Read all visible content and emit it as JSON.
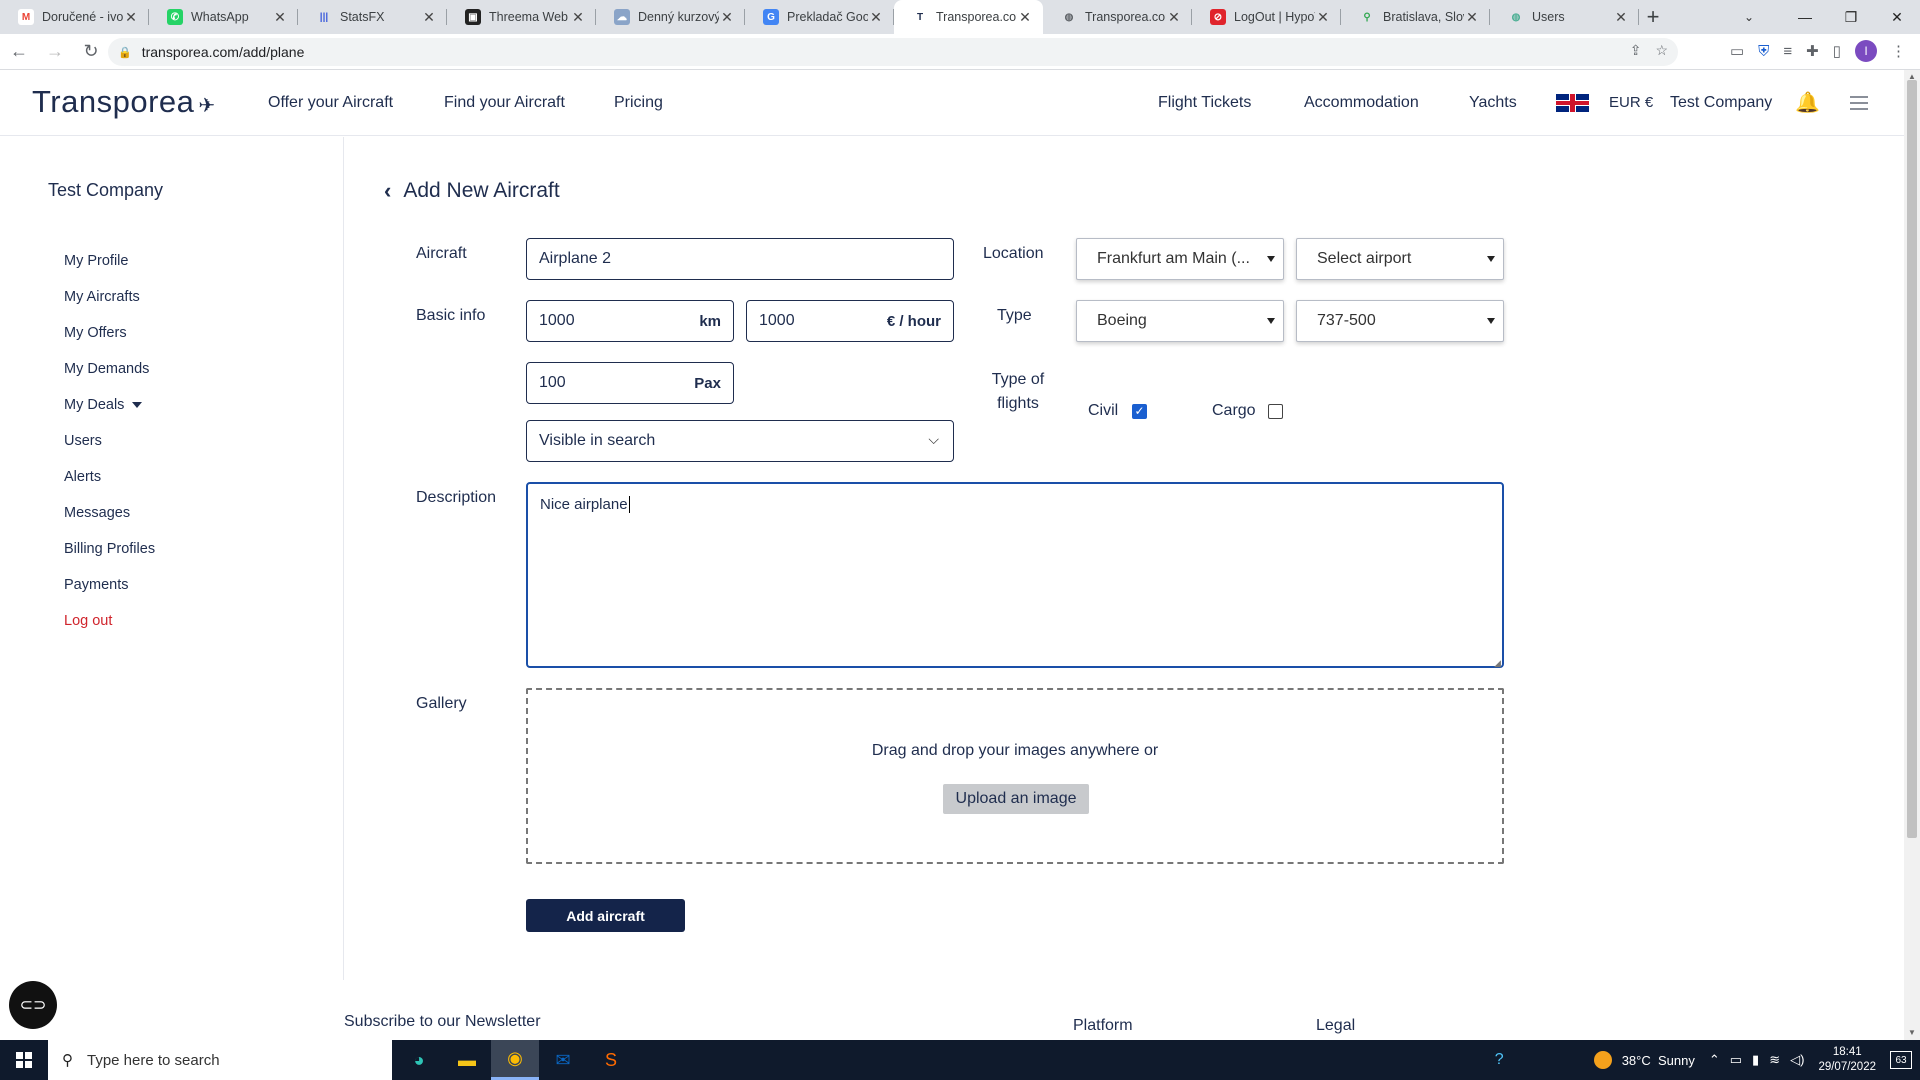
{
  "browser": {
    "tabs": [
      {
        "label": "Doručené - ivor",
        "favicon": "gmail-icon",
        "color": "#ea4335",
        "glyph": "M"
      },
      {
        "label": "WhatsApp",
        "favicon": "whatsapp-icon",
        "color": "#25d366",
        "glyph": "✆"
      },
      {
        "label": "StatsFX",
        "favicon": "statsfx-icon",
        "color": "#3b5bdb",
        "glyph": "|||"
      },
      {
        "label": "Threema Web",
        "favicon": "threema-icon",
        "color": "#222222",
        "glyph": "▣"
      },
      {
        "label": "Denný kurzový l",
        "favicon": "bank-icon",
        "color": "#8aa4c8",
        "glyph": "☁"
      },
      {
        "label": "Prekladač Goog",
        "favicon": "translate-icon",
        "color": "#4285f4",
        "glyph": "G"
      },
      {
        "label": "Transporea.com",
        "favicon": "transporea-icon",
        "color": "#ffffff",
        "glyph": "T",
        "active": true
      },
      {
        "label": "Transporea.com",
        "favicon": "globe-icon",
        "color": "#5f6368",
        "glyph": "◍"
      },
      {
        "label": "LogOut | HypoV",
        "favicon": "opera-icon",
        "color": "#e0242c",
        "glyph": "⊘"
      },
      {
        "label": "Bratislava, Slova",
        "favicon": "maps-icon",
        "color": "#34a853",
        "glyph": "⚲"
      },
      {
        "label": "Users",
        "favicon": "globe-icon",
        "color": "#4caf94",
        "glyph": "◍"
      }
    ],
    "url": "transporea.com/add/plane"
  },
  "header": {
    "logo": "Transporea",
    "nav": [
      "Offer your Aircraft",
      "Find your Aircraft",
      "Pricing"
    ],
    "right_nav": [
      "Flight Tickets",
      "Accommodation",
      "Yachts"
    ],
    "currency": "EUR €",
    "company": "Test Company"
  },
  "sidebar": {
    "company": "Test Company",
    "items": [
      "My Profile",
      "My Aircrafts",
      "My Offers",
      "My Demands",
      "My Deals",
      "Users",
      "Alerts",
      "Messages",
      "Billing Profiles",
      "Payments",
      "Log out"
    ]
  },
  "form": {
    "title": "Add New Aircraft",
    "labels": {
      "aircraft": "Aircraft",
      "basic_info": "Basic info",
      "location": "Location",
      "type": "Type",
      "type_of_flights": "Type of flights",
      "description": "Description",
      "gallery": "Gallery"
    },
    "aircraft_name": "Airplane 2",
    "range_value": "1000",
    "range_unit": "km",
    "price_value": "1000",
    "price_unit": "€ / hour",
    "pax_value": "100",
    "pax_unit": "Pax",
    "visibility": "Visible in search",
    "location_city": "Frankfurt am Main (...",
    "location_airport": "Select airport",
    "manufacturer": "Boeing",
    "model": "737-500",
    "flight_types": [
      {
        "label": "Civil",
        "checked": true
      },
      {
        "label": "Cargo",
        "checked": false
      }
    ],
    "description": "Nice airplane",
    "gallery_prompt": "Drag and drop your images anywhere or",
    "upload_label": "Upload an image",
    "submit_label": "Add aircraft"
  },
  "footer": {
    "newsletter": "Subscribe to our Newsletter",
    "platform": "Platform",
    "legal": "Legal"
  },
  "taskbar": {
    "search_placeholder": "Type here to search",
    "weather": "38°C  Sunny",
    "time": "18:41",
    "date": "29/07/2022",
    "notifications": "63"
  }
}
